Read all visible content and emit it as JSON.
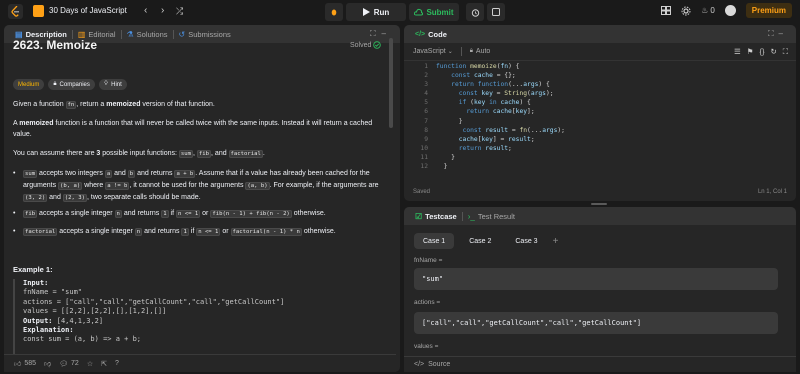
{
  "topbar": {
    "study_title": "30 Days of JavaScript",
    "run_label": "Run",
    "submit_label": "Submit",
    "streak_count": "0",
    "premium_label": "Premium"
  },
  "description_panel": {
    "tabs": [
      "Description",
      "Editorial",
      "Solutions",
      "Submissions"
    ],
    "title": "2623. Memoize",
    "status": "Solved",
    "badges": [
      "Medium",
      "Companies",
      "Hint"
    ],
    "intro_parts": [
      "Given a function ",
      "fn",
      ", return a ",
      "memoized",
      " version of that function."
    ],
    "def_parts": [
      "A ",
      "memoized",
      " function is a function that will never be called twice with the same inputs. Instead it will return a cached value."
    ],
    "assume_parts": [
      "You can assume there are ",
      "3",
      " possible input functions: ",
      "sum",
      ", ",
      "fib",
      ", and ",
      "factorial",
      "."
    ],
    "bullets": {
      "sum_a": "sum",
      "sum_b": " accepts two integers ",
      "sum_c": "a",
      "sum_d": " and ",
      "sum_e": "b",
      "sum_f": " and returns ",
      "sum_g": "a + b",
      "sum_h": ". Assume that if a value has already been cached for the arguments ",
      "sum_i": "(b, a)",
      "sum_j": " where ",
      "sum_k": "a != b",
      "sum_l": ", it cannot be used for the arguments ",
      "sum_m": "(a, b)",
      "sum_n": ". For example, if the arguments are ",
      "sum_o": "(3, 2)",
      "sum_p": " and ",
      "sum_q": "(2, 3)",
      "sum_r": ", two separate calls should be made.",
      "fib_a": "fib",
      "fib_b": " accepts a single integer ",
      "fib_c": "n",
      "fib_d": " and returns ",
      "fib_e": "1",
      "fib_f": " if ",
      "fib_g": "n <= 1",
      "fib_h": " or ",
      "fib_i": "fib(n - 1) + fib(n - 2)",
      "fib_j": " otherwise.",
      "fac_a": "factorial",
      "fac_b": " accepts a single integer ",
      "fac_c": "n",
      "fac_d": " and returns ",
      "fac_e": "1",
      "fac_f": " if ",
      "fac_g": "n <= 1",
      "fac_h": " or ",
      "fac_i": "factorial(n - 1) * n",
      "fac_j": " otherwise."
    },
    "example_title": "Example 1:",
    "example": {
      "input_label": "Input:",
      "line1": "fnName = \"sum\"",
      "line2": "actions = [\"call\",\"call\",\"getCallCount\",\"call\",\"getCallCount\"]",
      "line3": "values = [[2,2],[2,2],[],[1,2],[]]",
      "output_label": "Output:",
      "output_value": " [4,4,1,3,2]",
      "explanation_label": "Explanation:",
      "line4": "const sum = (a, b) => a + b;"
    },
    "footer": {
      "likes": "585",
      "comments": "72"
    }
  },
  "code_panel": {
    "title": "Code",
    "language": "JavaScript",
    "auto_label": "Auto",
    "line_numbers": [
      "1",
      "2",
      "3",
      "4",
      "5",
      "6",
      "7",
      "8",
      "9",
      "10",
      "11",
      "12"
    ],
    "saved_label": "Saved",
    "cursor_pos": "Ln 1, Col 1"
  },
  "test_panel": {
    "tabs": [
      "Testcase",
      "Test Result"
    ],
    "cases": [
      "Case 1",
      "Case 2",
      "Case 3"
    ],
    "fields": [
      {
        "label": "fnName =",
        "value": "\"sum\""
      },
      {
        "label": "actions =",
        "value": "[\"call\",\"call\",\"getCallCount\",\"call\",\"getCallCount\"]"
      },
      {
        "label": "values =",
        "value": ""
      }
    ],
    "source_label": "Source"
  },
  "colors": {
    "accent": "#ffa116",
    "success": "#2cbb5d",
    "medium": "#ffb800",
    "link": "#4a90e2"
  }
}
